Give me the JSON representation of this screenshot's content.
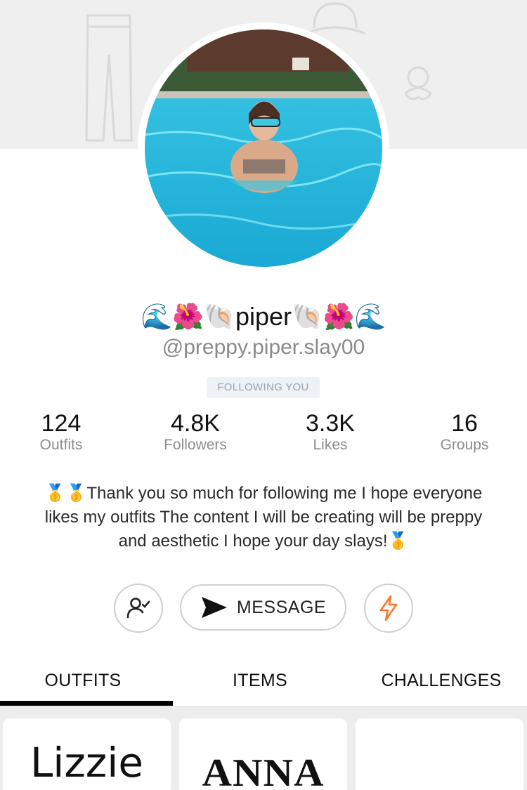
{
  "profile": {
    "display_name": "🌊🌺🐚piper🐚🌺🌊",
    "username": "@preppy.piper.slay00",
    "follow_status": "FOLLOWING YOU",
    "avatar_description": "girl in pool"
  },
  "stats": [
    {
      "value": "124",
      "label": "Outfits"
    },
    {
      "value": "4.8K",
      "label": "Followers"
    },
    {
      "value": "3.3K",
      "label": "Likes"
    },
    {
      "value": "16",
      "label": "Groups"
    }
  ],
  "bio": "🥇🥇Thank you so much for following me I hope everyone likes my outfits The content I will be creating will be preppy and aesthetic I hope your day slays!🥇",
  "actions": {
    "message_label": "MESSAGE",
    "follow_icon": "user-check-icon",
    "boost_icon": "lightning-icon",
    "send_icon": "send-icon",
    "accent_color": "#f4792b"
  },
  "tabs": [
    {
      "label": "OUTFITS",
      "active": true
    },
    {
      "label": "ITEMS",
      "active": false
    },
    {
      "label": "CHALLENGES",
      "active": false
    }
  ],
  "outfit_cards": [
    {
      "title": "Lizzie"
    },
    {
      "title": "ANNA"
    },
    {
      "title": ""
    }
  ]
}
